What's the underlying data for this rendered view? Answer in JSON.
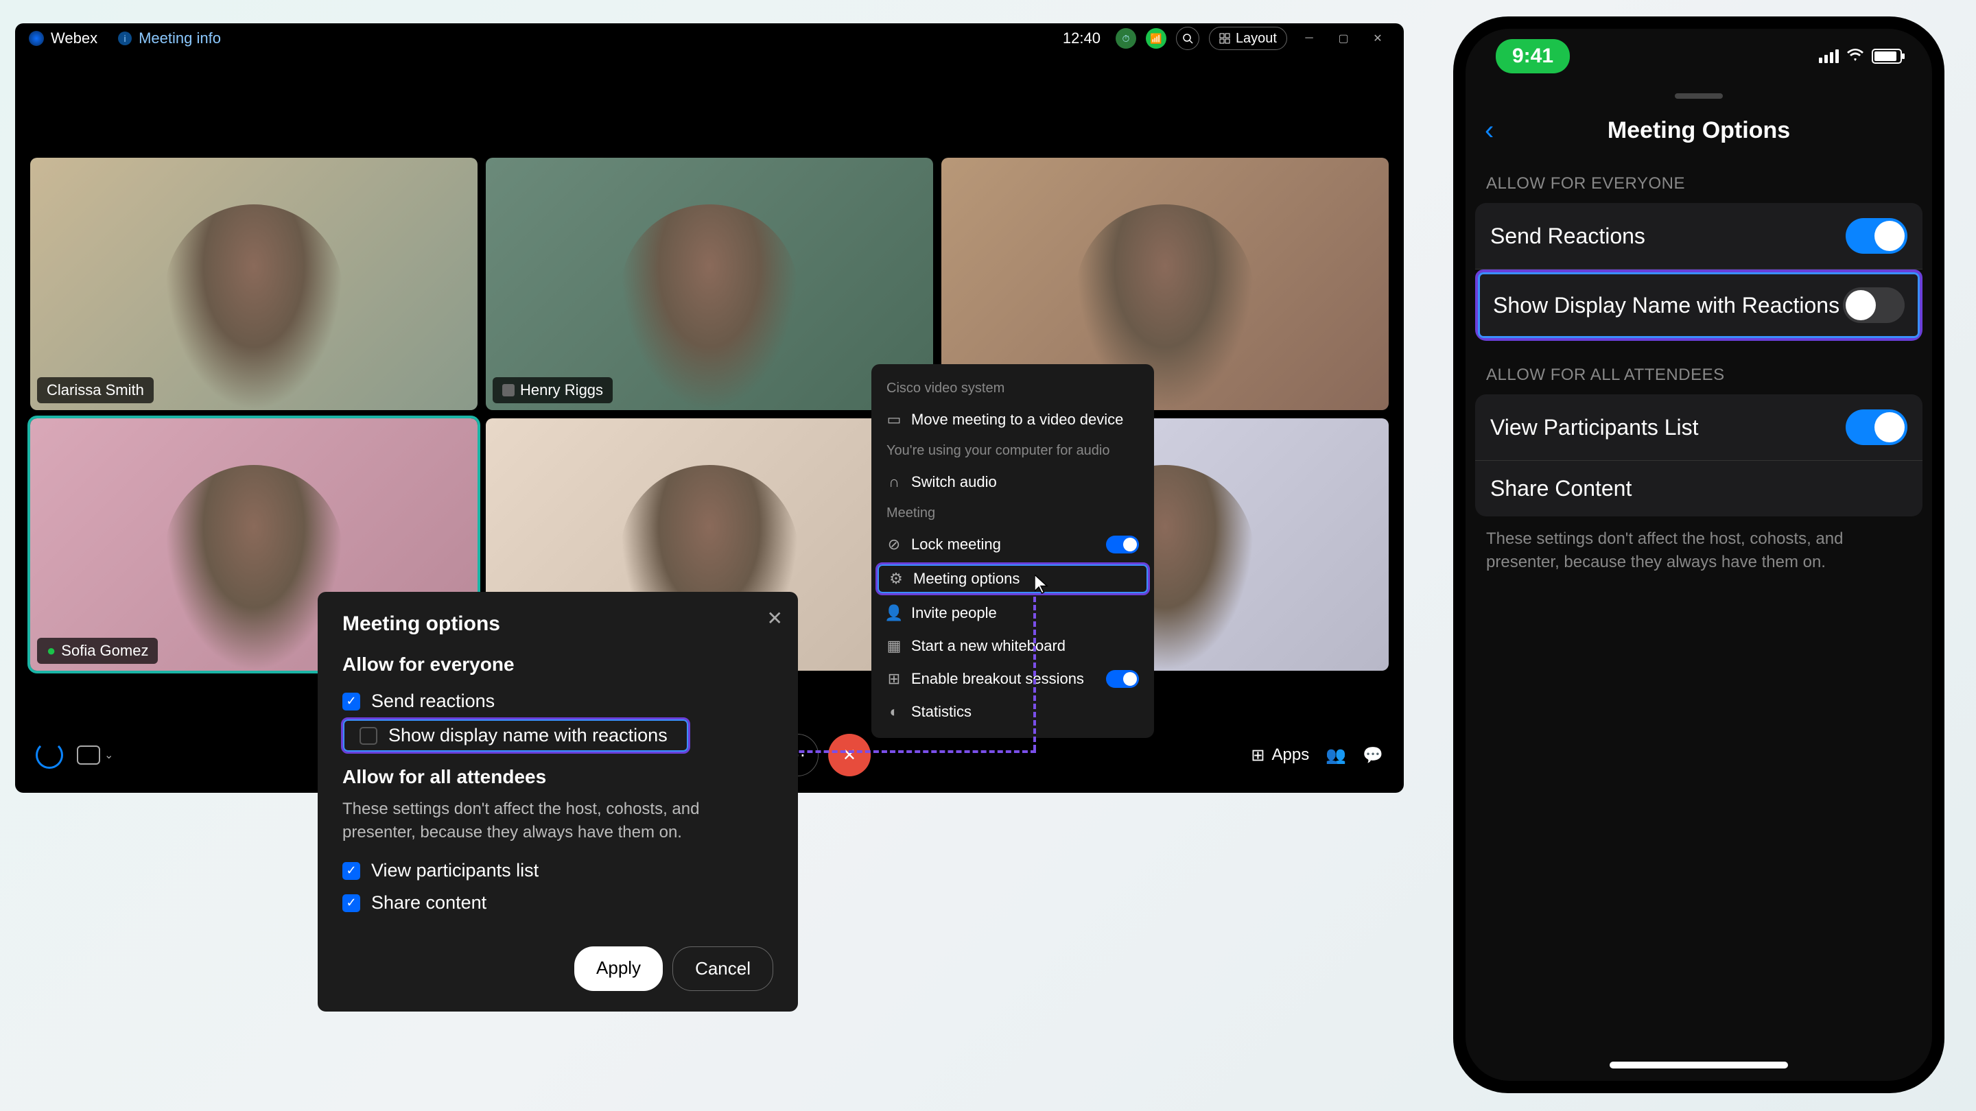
{
  "desktop": {
    "brand": "Webex",
    "meeting_info": "Meeting info",
    "clock": "12:40",
    "layout_label": "Layout",
    "participants": [
      {
        "name": "Clarissa Smith",
        "muted": false
      },
      {
        "name": "Henry Riggs",
        "muted": true
      },
      {
        "name": "",
        "muted": false
      },
      {
        "name": "Sofia Gomez",
        "muted": false
      },
      {
        "name": "",
        "muted": false
      },
      {
        "name": "",
        "muted": false
      }
    ],
    "context_menu": {
      "header1": "Cisco video system",
      "move_device": "Move meeting to a video device",
      "audio_note": "You're using your computer for audio",
      "switch_audio": "Switch audio",
      "header2": "Meeting",
      "lock_meeting": "Lock meeting",
      "meeting_options": "Meeting options",
      "invite_people": "Invite people",
      "start_whiteboard": "Start a new whiteboard",
      "enable_breakout": "Enable breakout sessions",
      "statistics": "Statistics"
    },
    "toolbar": {
      "record_label": "Record",
      "apps_label": "Apps"
    },
    "dialog": {
      "title": "Meeting options",
      "section1_title": "Allow for everyone",
      "send_reactions": "Send reactions",
      "show_display_name": "Show display name with reactions",
      "section2_title": "Allow for all attendees",
      "section2_desc": "These settings don't affect the host, cohosts, and presenter, because they always have them on.",
      "view_participants": "View participants list",
      "share_content": "Share content",
      "apply": "Apply",
      "cancel": "Cancel"
    }
  },
  "mobile": {
    "time": "9:41",
    "title": "Meeting Options",
    "section1_header": "ALLOW FOR EVERYONE",
    "send_reactions": "Send Reactions",
    "show_display_name": "Show Display Name with Reactions",
    "section2_header": "ALLOW FOR ALL ATTENDEES",
    "view_participants": "View Participants List",
    "share_content": "Share Content",
    "footnote": "These settings don't affect the host, cohosts, and presenter, because they always have them on."
  }
}
